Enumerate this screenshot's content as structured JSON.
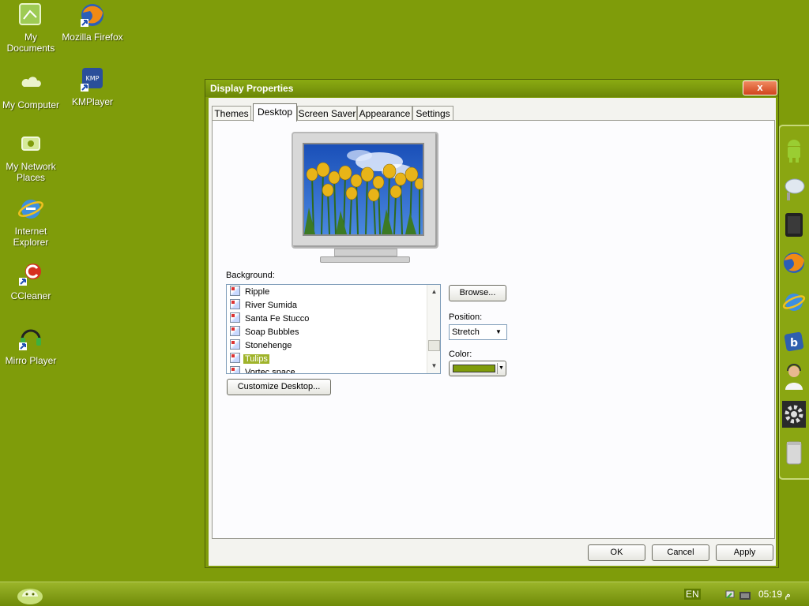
{
  "desktop": {
    "icons": [
      {
        "label_line1": "My",
        "label_line2": "Documents",
        "icon": "folder-documents-icon"
      },
      {
        "label_line1": "Mozilla Firefox",
        "label_line2": "",
        "icon": "firefox-icon"
      },
      {
        "label_line1": "My Computer",
        "label_line2": "",
        "icon": "computer-icon"
      },
      {
        "label_line1": "KMPlayer",
        "label_line2": "",
        "icon": "kmplayer-icon"
      },
      {
        "label_line1": "My Network",
        "label_line2": "Places",
        "icon": "network-places-icon"
      },
      {
        "label_line1": "Internet",
        "label_line2": "Explorer",
        "icon": "internet-explorer-icon"
      },
      {
        "label_line1": "CCleaner",
        "label_line2": "",
        "icon": "ccleaner-icon"
      },
      {
        "label_line1": "Mirro Player",
        "label_line2": "",
        "icon": "mirro-player-icon"
      }
    ]
  },
  "window": {
    "title": "Display Properties",
    "close_label": "x",
    "tabs": [
      {
        "label": "Themes"
      },
      {
        "label": "Desktop"
      },
      {
        "label": "Screen Saver"
      },
      {
        "label": "Appearance"
      },
      {
        "label": "Settings"
      }
    ],
    "active_tab": "Desktop",
    "background_label": "Background:",
    "background_items": [
      {
        "label": "Ripple"
      },
      {
        "label": "River Sumida"
      },
      {
        "label": "Santa Fe Stucco"
      },
      {
        "label": "Soap Bubbles"
      },
      {
        "label": "Stonehenge"
      },
      {
        "label": "Tulips"
      },
      {
        "label": "Vortec space"
      }
    ],
    "selected_background": "Tulips",
    "browse_label": "Browse...",
    "position_label": "Position:",
    "position_value": "Stretch",
    "color_label": "Color:",
    "color_value": "#7f9c0a",
    "customize_label": "Customize Desktop...",
    "ok_label": "OK",
    "cancel_label": "Cancel",
    "apply_label": "Apply"
  },
  "taskbar": {
    "language": "EN",
    "clock": "05:19 م"
  },
  "colors": {
    "desktop": "#7f9c0a",
    "selection": "#9fb32a"
  }
}
